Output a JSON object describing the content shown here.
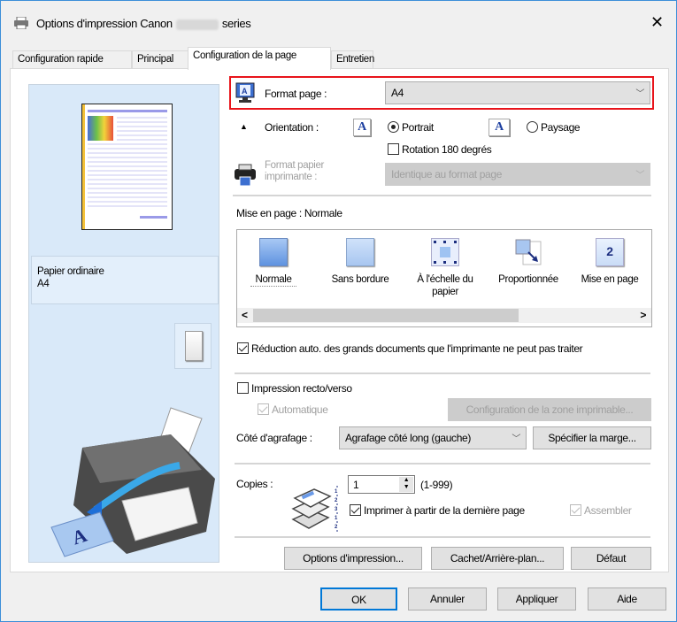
{
  "window": {
    "title_prefix": "Options d'impression Canon",
    "title_suffix": "series",
    "close": "✕"
  },
  "tabs": [
    {
      "label": "Configuration rapide"
    },
    {
      "label": "Principal"
    },
    {
      "label": "Configuration de la page",
      "selected": true
    },
    {
      "label": "Entretien"
    }
  ],
  "preview": {
    "media_type": "Papier ordinaire",
    "media_size": "A4"
  },
  "format_page": {
    "label": "Format page :",
    "value": "A4"
  },
  "orientation": {
    "label": "Orientation :",
    "portrait": "Portrait",
    "paysage": "Paysage",
    "selected": "Portrait",
    "icon_letter": "A"
  },
  "rotation": {
    "label": "Rotation 180 degrés",
    "checked": false
  },
  "format_papier": {
    "label_line1": "Format papier",
    "label_line2": "imprimante :",
    "value": "Identique au format page"
  },
  "mise_en_page": {
    "label": "Mise en page :",
    "value": "Normale",
    "items": [
      {
        "label": "Normale"
      },
      {
        "label": "Sans bordure"
      },
      {
        "label": "À l'échelle du papier"
      },
      {
        "label": "Proportionnée"
      },
      {
        "label": "Mise en page",
        "badge": "2"
      }
    ],
    "scroll_left": "<",
    "scroll_right": ">"
  },
  "reduction": {
    "label": "Réduction auto. des grands documents que l'imprimante ne peut pas traiter",
    "checked": true
  },
  "recto_verso": {
    "label": "Impression recto/verso",
    "checked": false,
    "auto_label": "Automatique",
    "auto_checked": true,
    "zone_button": "Configuration de la zone imprimable..."
  },
  "agrafage": {
    "label": "Côté d'agrafage :",
    "value": "Agrafage côté long (gauche)",
    "marge_button": "Spécifier la marge..."
  },
  "copies": {
    "label": "Copies :",
    "value": "1",
    "range": "(1-999)",
    "derniere_page": "Imprimer à partir de la dernière page",
    "derniere_checked": true,
    "assembler": "Assembler",
    "assembler_checked": true
  },
  "buttons": {
    "options": "Options d'impression...",
    "cachet": "Cachet/Arrière-plan...",
    "defaut": "Défaut"
  },
  "footer": {
    "ok": "OK",
    "annuler": "Annuler",
    "appliquer": "Appliquer",
    "aide": "Aide"
  },
  "colors": {
    "highlight": "#e8141b",
    "preview_bg": "#d9e9f9",
    "accent": "#3c8fd8"
  }
}
